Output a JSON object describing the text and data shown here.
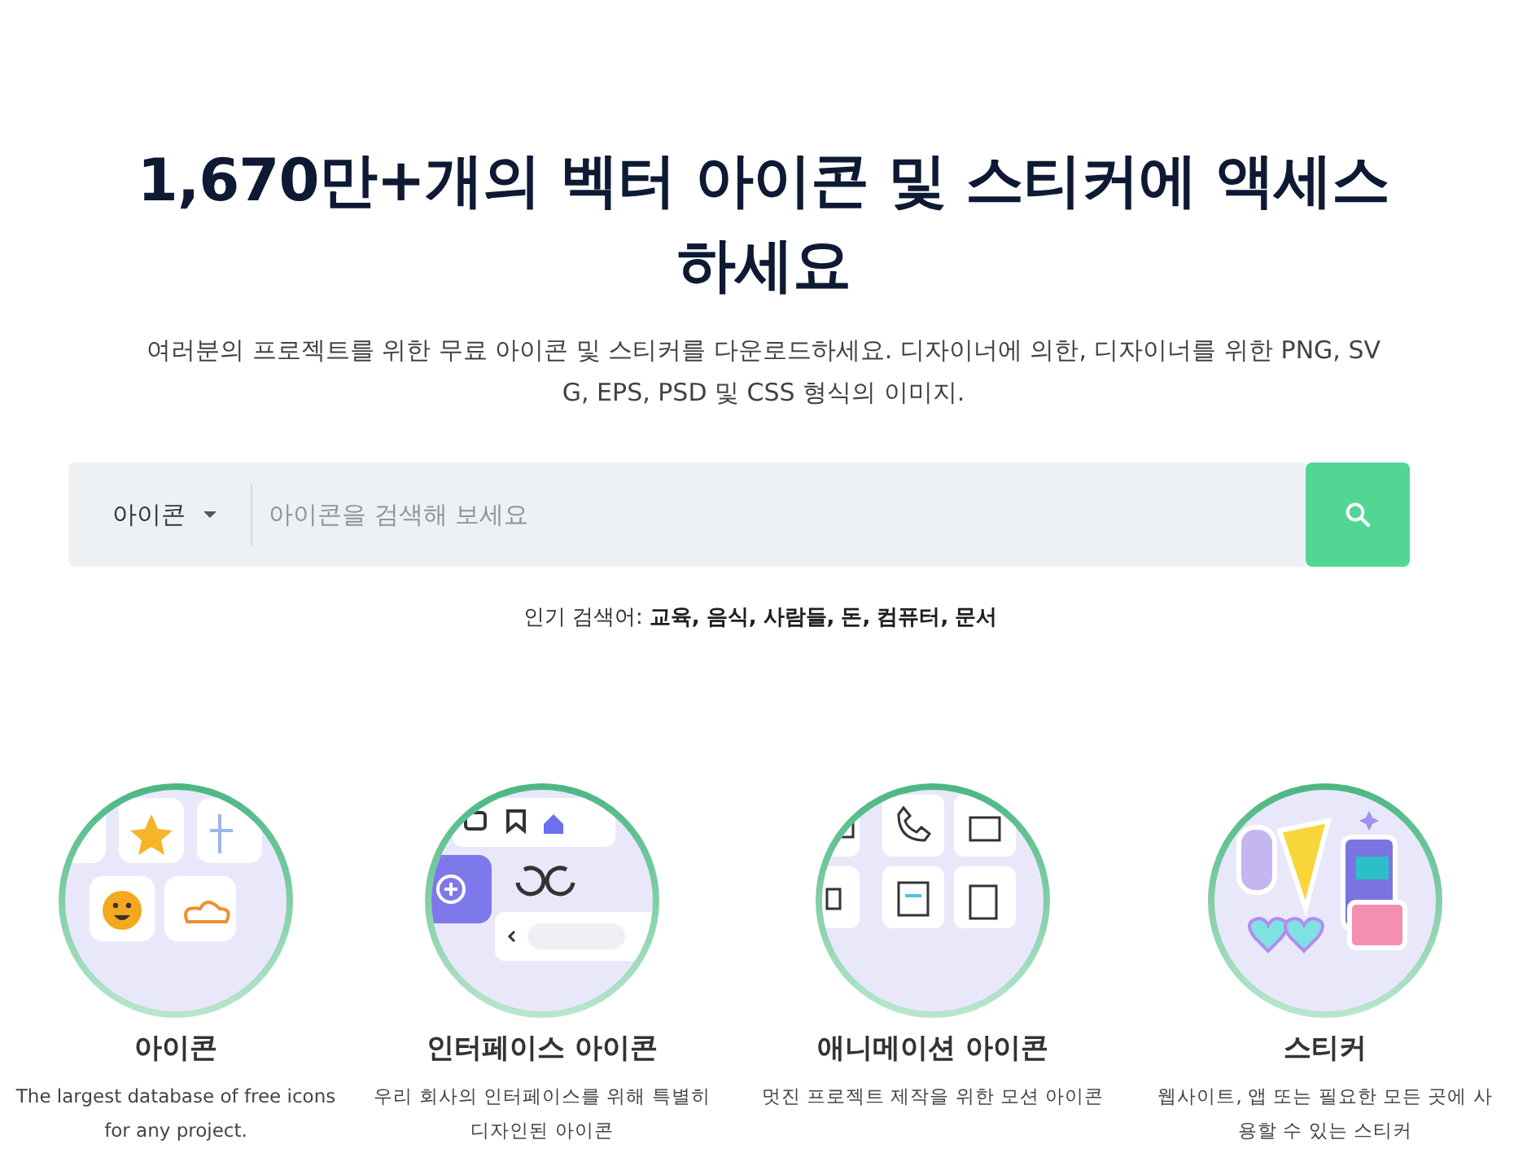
{
  "hero": {
    "title": "1,670만+개의 벡터 아이콘 및 스티커에 액세스하세요",
    "subtitle": "여러분의 프로젝트를 위한 무료 아이콘 및 스티커를 다운로드하세요. 디자이너에 의한, 디자이너를 위한 PNG, SVG, EPS, PSD 및 CSS 형식의 이미지."
  },
  "search": {
    "category": "아이콘",
    "placeholder": "아이콘을 검색해 보세요"
  },
  "popular": {
    "label": "인기 검색어:",
    "terms": [
      "교육,",
      "음식,",
      "사람들,",
      "돈,",
      "컴퓨터,",
      "문서"
    ]
  },
  "categories": [
    {
      "kind": "icons",
      "title": "아이콘",
      "description": "The largest database of free icons for any project."
    },
    {
      "kind": "interface",
      "title": "인터페이스 아이콘",
      "description": "우리 회사의 인터페이스를 위해 특별히 디자인된 아이콘"
    },
    {
      "kind": "animated",
      "title": "애니메이션 아이콘",
      "description": "멋진 프로젝트 제작을 위한 모션 아이콘"
    },
    {
      "kind": "stickers",
      "title": "스티커",
      "description": "웹사이트, 앱 또는 필요한 모든 곳에 사용할 수 있는 스티커"
    }
  ]
}
